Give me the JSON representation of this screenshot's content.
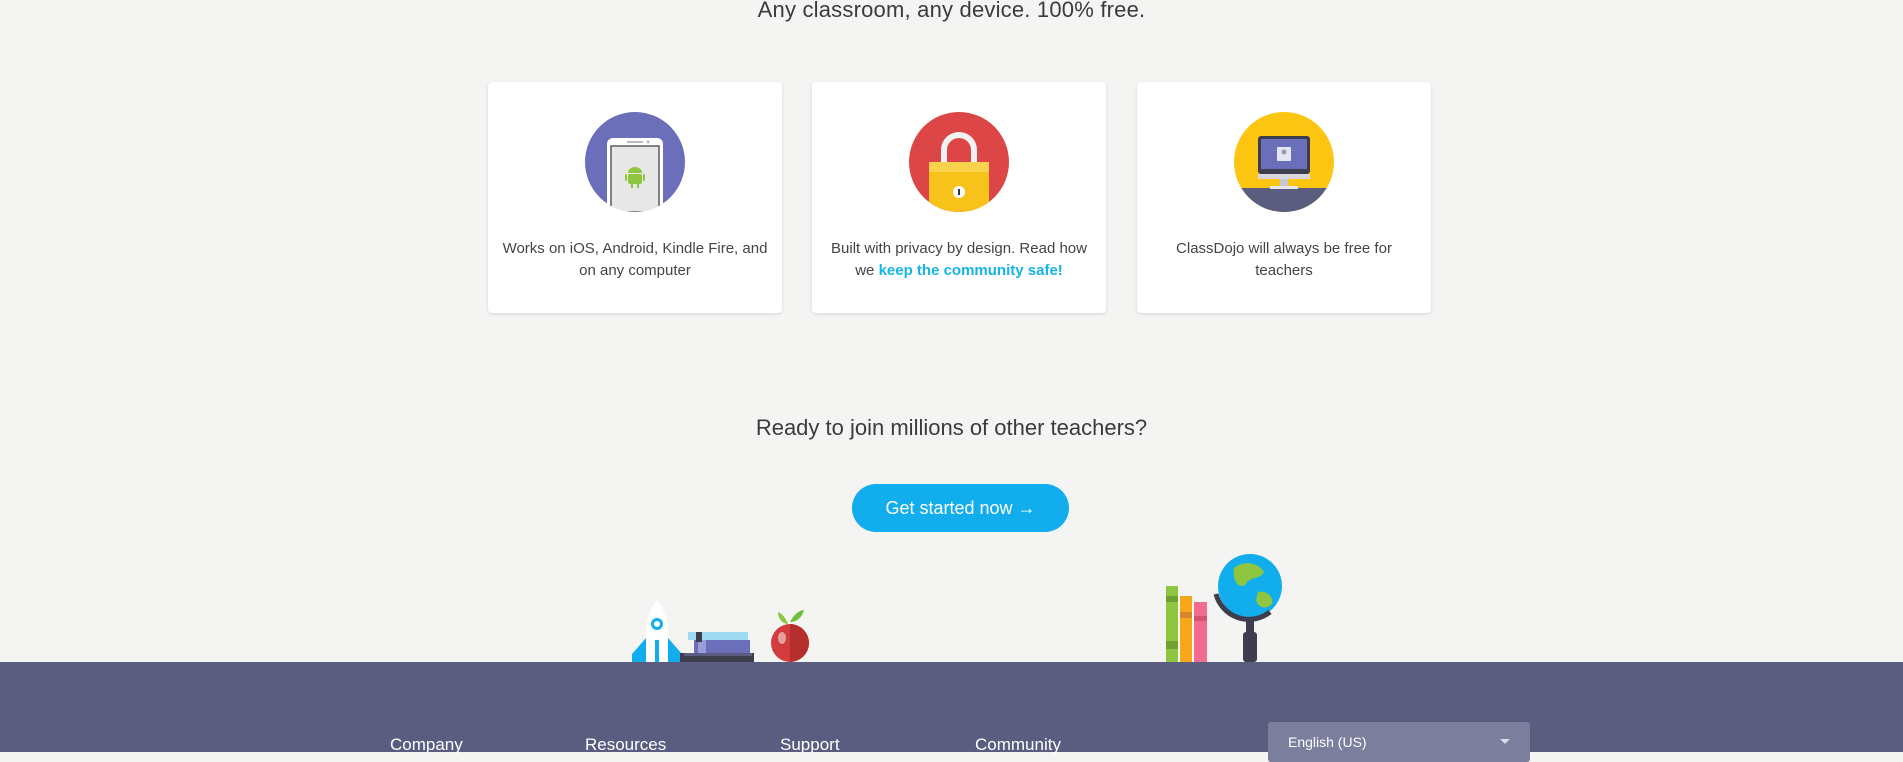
{
  "tagline": "Any classroom, any device. 100% free.",
  "features": [
    {
      "icon": "tablet-android-icon",
      "text": "Works on iOS, Android, Kindle Fire, and on any computer"
    },
    {
      "icon": "padlock-icon",
      "text_before": "Built with privacy by design. Read how we ",
      "link": "keep the community safe!"
    },
    {
      "icon": "computer-monitor-icon",
      "text": "ClassDojo will always be free for teachers"
    }
  ],
  "cta": {
    "heading": "Ready to join millions of other teachers?",
    "button_label": "Get started now →"
  },
  "footer": {
    "columns": [
      "Company",
      "Resources",
      "Support",
      "Community"
    ],
    "language": "English (US)"
  },
  "colors": {
    "background": "#f4f4f2",
    "accent": "#12adec",
    "link": "#16b4e6",
    "footer": "#5a5d80"
  }
}
